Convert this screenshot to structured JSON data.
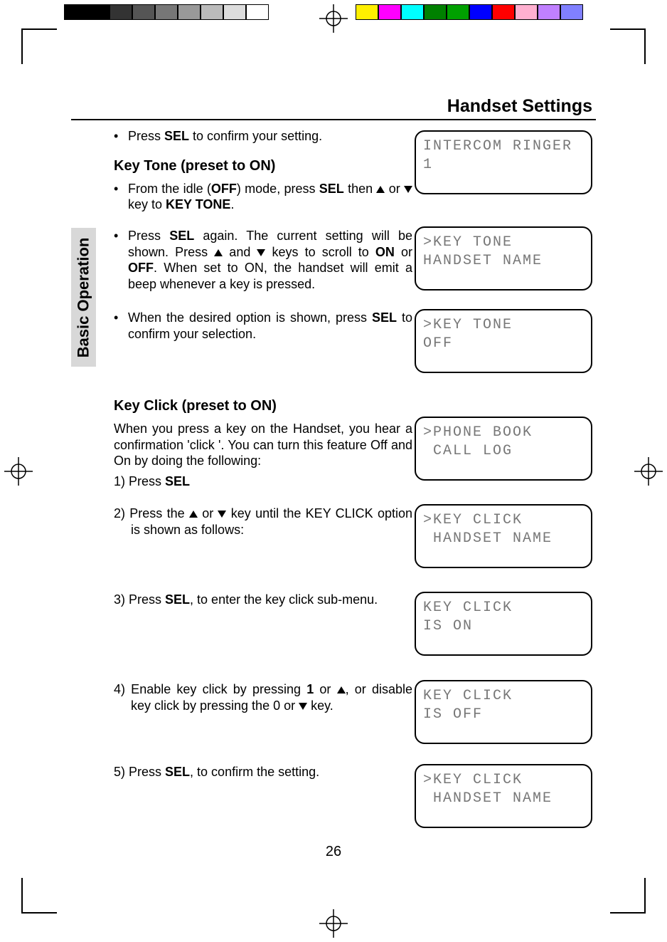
{
  "title": "Handset Settings",
  "sideTab": "Basic Operation",
  "pressSel": "Press <b>SEL</b> to confirm your setting.",
  "keyTone": {
    "heading": "Key Tone (preset to ON)",
    "b1": "From the idle (<b>OFF</b>) mode, press <b>SEL</b> then {UP} or {DOWN} key to <b>KEY TONE</b>.",
    "b2": " Press <b>SEL</b> again.  The current setting will be shown.  Press {UP} and {DOWN} keys to scroll to <b>ON</b> or <b>OFF</b>.  When set to ON, the handset will emit a beep whenever a key is pressed.",
    "b3": "When the desired option is shown, press <b>SEL</b> to confirm your selection."
  },
  "keyClick": {
    "heading": "Key Click (preset to ON)",
    "intro": "When you press a key on the Handset, you hear a confirmation 'click '. You can turn this feature Off and On by doing the following:",
    "s1": "1) Press <b>SEL</b>",
    "s2": "2) Press the  {UP} or {DOWN} key until the KEY CLICK option is shown as follows:",
    "s3": "3) Press <b>SEL</b>, to enter the key click sub-menu.",
    "s4": "4) Enable key click by pressing <b>1</b> or {UP}, or disable key click by pressing the 0 or {DOWN} key.",
    "s5": "5) Press <b>SEL</b>, to confirm the setting."
  },
  "lcd": {
    "d1": "INTERCOM RINGER\n1",
    "d2": ">KEY TONE\nHANDSET NAME",
    "d3": ">KEY TONE\nOFF",
    "d4": ">PHONE BOOK\n CALL LOG",
    "d5": ">KEY CLICK\n HANDSET NAME",
    "d6": "KEY CLICK\nIS ON",
    "d7": "KEY CLICK\nIS OFF",
    "d8": ">KEY CLICK\n HANDSET NAME"
  },
  "pageNumber": "26",
  "colorBars": {
    "left": [
      "#000",
      "#000",
      "#333",
      "#555",
      "#777",
      "#999",
      "#bbb",
      "#ddd",
      "#fff"
    ],
    "right": [
      "#fff000",
      "#ff00ff",
      "#00ffff",
      "#008000",
      "#00a000",
      "#0000ff",
      "#ff0000",
      "#ffb0d0",
      "#c080ff",
      "#8080ff"
    ]
  }
}
